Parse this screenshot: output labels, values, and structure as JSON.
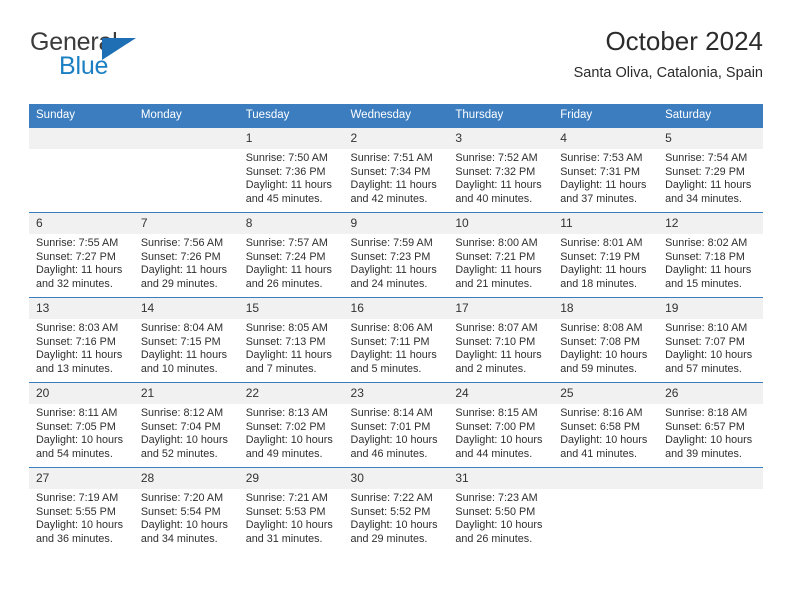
{
  "logo": {
    "word_top": "General",
    "word_bottom": "Blue",
    "triangle_color": "#1f6fb5",
    "blue_color": "#1b7fc4"
  },
  "header": {
    "title": "October 2024",
    "subtitle": "Santa Oliva, Catalonia, Spain"
  },
  "theme": {
    "header_blue": "#3b7dbf",
    "daynum_band": "#f1f1f1",
    "text": "#2f2f2f"
  },
  "calendar": {
    "weekday_headers": [
      "Sunday",
      "Monday",
      "Tuesday",
      "Wednesday",
      "Thursday",
      "Friday",
      "Saturday"
    ],
    "weeks": [
      [
        {
          "day": "",
          "empty": true
        },
        {
          "day": "",
          "empty": true
        },
        {
          "day": "1",
          "sunrise": "Sunrise: 7:50 AM",
          "sunset": "Sunset: 7:36 PM",
          "daylight": "Daylight: 11 hours and 45 minutes."
        },
        {
          "day": "2",
          "sunrise": "Sunrise: 7:51 AM",
          "sunset": "Sunset: 7:34 PM",
          "daylight": "Daylight: 11 hours and 42 minutes."
        },
        {
          "day": "3",
          "sunrise": "Sunrise: 7:52 AM",
          "sunset": "Sunset: 7:32 PM",
          "daylight": "Daylight: 11 hours and 40 minutes."
        },
        {
          "day": "4",
          "sunrise": "Sunrise: 7:53 AM",
          "sunset": "Sunset: 7:31 PM",
          "daylight": "Daylight: 11 hours and 37 minutes."
        },
        {
          "day": "5",
          "sunrise": "Sunrise: 7:54 AM",
          "sunset": "Sunset: 7:29 PM",
          "daylight": "Daylight: 11 hours and 34 minutes."
        }
      ],
      [
        {
          "day": "6",
          "sunrise": "Sunrise: 7:55 AM",
          "sunset": "Sunset: 7:27 PM",
          "daylight": "Daylight: 11 hours and 32 minutes."
        },
        {
          "day": "7",
          "sunrise": "Sunrise: 7:56 AM",
          "sunset": "Sunset: 7:26 PM",
          "daylight": "Daylight: 11 hours and 29 minutes."
        },
        {
          "day": "8",
          "sunrise": "Sunrise: 7:57 AM",
          "sunset": "Sunset: 7:24 PM",
          "daylight": "Daylight: 11 hours and 26 minutes."
        },
        {
          "day": "9",
          "sunrise": "Sunrise: 7:59 AM",
          "sunset": "Sunset: 7:23 PM",
          "daylight": "Daylight: 11 hours and 24 minutes."
        },
        {
          "day": "10",
          "sunrise": "Sunrise: 8:00 AM",
          "sunset": "Sunset: 7:21 PM",
          "daylight": "Daylight: 11 hours and 21 minutes."
        },
        {
          "day": "11",
          "sunrise": "Sunrise: 8:01 AM",
          "sunset": "Sunset: 7:19 PM",
          "daylight": "Daylight: 11 hours and 18 minutes."
        },
        {
          "day": "12",
          "sunrise": "Sunrise: 8:02 AM",
          "sunset": "Sunset: 7:18 PM",
          "daylight": "Daylight: 11 hours and 15 minutes."
        }
      ],
      [
        {
          "day": "13",
          "sunrise": "Sunrise: 8:03 AM",
          "sunset": "Sunset: 7:16 PM",
          "daylight": "Daylight: 11 hours and 13 minutes."
        },
        {
          "day": "14",
          "sunrise": "Sunrise: 8:04 AM",
          "sunset": "Sunset: 7:15 PM",
          "daylight": "Daylight: 11 hours and 10 minutes."
        },
        {
          "day": "15",
          "sunrise": "Sunrise: 8:05 AM",
          "sunset": "Sunset: 7:13 PM",
          "daylight": "Daylight: 11 hours and 7 minutes."
        },
        {
          "day": "16",
          "sunrise": "Sunrise: 8:06 AM",
          "sunset": "Sunset: 7:11 PM",
          "daylight": "Daylight: 11 hours and 5 minutes."
        },
        {
          "day": "17",
          "sunrise": "Sunrise: 8:07 AM",
          "sunset": "Sunset: 7:10 PM",
          "daylight": "Daylight: 11 hours and 2 minutes."
        },
        {
          "day": "18",
          "sunrise": "Sunrise: 8:08 AM",
          "sunset": "Sunset: 7:08 PM",
          "daylight": "Daylight: 10 hours and 59 minutes."
        },
        {
          "day": "19",
          "sunrise": "Sunrise: 8:10 AM",
          "sunset": "Sunset: 7:07 PM",
          "daylight": "Daylight: 10 hours and 57 minutes."
        }
      ],
      [
        {
          "day": "20",
          "sunrise": "Sunrise: 8:11 AM",
          "sunset": "Sunset: 7:05 PM",
          "daylight": "Daylight: 10 hours and 54 minutes."
        },
        {
          "day": "21",
          "sunrise": "Sunrise: 8:12 AM",
          "sunset": "Sunset: 7:04 PM",
          "daylight": "Daylight: 10 hours and 52 minutes."
        },
        {
          "day": "22",
          "sunrise": "Sunrise: 8:13 AM",
          "sunset": "Sunset: 7:02 PM",
          "daylight": "Daylight: 10 hours and 49 minutes."
        },
        {
          "day": "23",
          "sunrise": "Sunrise: 8:14 AM",
          "sunset": "Sunset: 7:01 PM",
          "daylight": "Daylight: 10 hours and 46 minutes."
        },
        {
          "day": "24",
          "sunrise": "Sunrise: 8:15 AM",
          "sunset": "Sunset: 7:00 PM",
          "daylight": "Daylight: 10 hours and 44 minutes."
        },
        {
          "day": "25",
          "sunrise": "Sunrise: 8:16 AM",
          "sunset": "Sunset: 6:58 PM",
          "daylight": "Daylight: 10 hours and 41 minutes."
        },
        {
          "day": "26",
          "sunrise": "Sunrise: 8:18 AM",
          "sunset": "Sunset: 6:57 PM",
          "daylight": "Daylight: 10 hours and 39 minutes."
        }
      ],
      [
        {
          "day": "27",
          "sunrise": "Sunrise: 7:19 AM",
          "sunset": "Sunset: 5:55 PM",
          "daylight": "Daylight: 10 hours and 36 minutes."
        },
        {
          "day": "28",
          "sunrise": "Sunrise: 7:20 AM",
          "sunset": "Sunset: 5:54 PM",
          "daylight": "Daylight: 10 hours and 34 minutes."
        },
        {
          "day": "29",
          "sunrise": "Sunrise: 7:21 AM",
          "sunset": "Sunset: 5:53 PM",
          "daylight": "Daylight: 10 hours and 31 minutes."
        },
        {
          "day": "30",
          "sunrise": "Sunrise: 7:22 AM",
          "sunset": "Sunset: 5:52 PM",
          "daylight": "Daylight: 10 hours and 29 minutes."
        },
        {
          "day": "31",
          "sunrise": "Sunrise: 7:23 AM",
          "sunset": "Sunset: 5:50 PM",
          "daylight": "Daylight: 10 hours and 26 minutes."
        },
        {
          "day": "",
          "empty": true
        },
        {
          "day": "",
          "empty": true
        }
      ]
    ]
  }
}
